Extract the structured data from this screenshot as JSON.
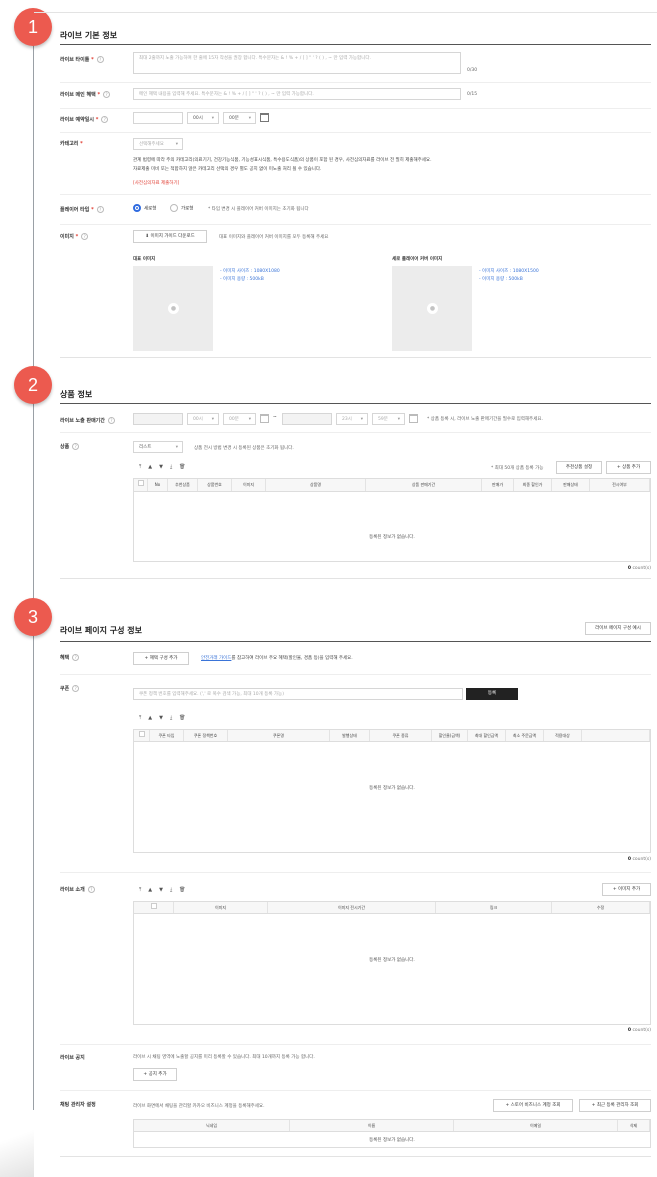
{
  "steps": [
    "1",
    "2",
    "3"
  ],
  "s1": {
    "title": "라이브 기본 정보",
    "live_title_label": "라이브 타이틀",
    "live_title_ph": "최대 2줄까지 노출 가능하며 한 줄에 15자 작성을 권장 합니다. 특수문자는 & ! % + / [ ] \" ' ? ( ) , ~ 만 입력 가능합니다.",
    "live_title_count": "0/30",
    "benefit_label": "라이브 메인 혜택",
    "benefit_ph": "메인 혜택 내용을 입력해 주세요. 특수문자는 & ! % + / [ ] \" ' ? ( ) , ~ 만 입력 가능합니다.",
    "benefit_count": "0/15",
    "schedule_label": "라이브 예약일시",
    "hour": "00시",
    "minute": "00분",
    "category_label": "카테고리",
    "category_select": "선택해주세요",
    "category_note1": "관계 법령에 따라 주의 카테고리(의료기기, 건강기능식품, 기능성표시식품, 특수용도식품)의 상품이 포함 된 경우, 사전심의자료를 라이브 전 필히 제출해주세요.",
    "category_note2": "자료제출 미비 또는 적합하지 않은 카테고리 선택의 경우 별도 공지 없이 미노출 처리 될 수 있습니다.",
    "category_link": "[사전심의자료 제출하기]",
    "player_label": "플레이어 타입",
    "player_vertical": "세로형",
    "player_horizontal": "가로형",
    "player_note": "* 타입 변경 시 플레이어 커버 이미지는 초기화 됩니다",
    "image_label": "이미지",
    "image_guide_btn": "이미지 가이드 다운로드",
    "image_note": "대표 이미지와 플레이어 커버 이미지를 모두 등록해 주세요",
    "rep_image_title": "대표 이미지",
    "rep_size": "- 이미지 사이즈 : 1080X1080",
    "rep_capacity": "- 이미지 용량 : 500kB",
    "cover_image_title": "세로 플레이어 커버 이미지",
    "cover_size": "- 이미지 사이즈 : 1080X1500",
    "cover_capacity": "- 이미지 용량 : 500kB"
  },
  "s2": {
    "title": "상품 정보",
    "period_label": "라이브 노출 판매기간",
    "start_hour": "00시",
    "start_min": "00분",
    "tilde": "~",
    "end_hour": "23시",
    "end_min": "59분",
    "period_note": "* 상품 등록 시, 라이브 노출 판매기간을 필수로 입력해주세요.",
    "product_label": "상품",
    "view_select": "리스트",
    "view_note": "상품 전시 방법 변경 시 등록된 상품은 초기화 됩니다.",
    "max_note": "* 최대 50개 상품 등록 가능",
    "recommend_btn": "추천상품 설정",
    "add_product_btn": "상품 추가",
    "columns": [
      "No",
      "추천상품",
      "상품번호",
      "이미지",
      "상품명",
      "상품 판매기간",
      "판매가",
      "최종 할인가",
      "판매상태",
      "전시여부"
    ],
    "empty": "등록된 정보가 없습니다.",
    "count_num": "0",
    "count_unit": "count(s)"
  },
  "s3": {
    "title": "라이브 페이지 구성 정보",
    "example_btn": "라이브 페이지 구성 예시",
    "benefit_label": "혜택",
    "benefit_btn": "혜택 구성 추가",
    "benefit_link": "안전거래 가이드",
    "benefit_note": "를 참고하여 라이브 주요 혜택(할인율, 경품 등)을 입력해 주세요.",
    "coupon_label": "쿠폰",
    "coupon_ph": "쿠폰 정책 번호를 입력해주세요. (',' 로 복수 검색 가능, 최대 10개 등록 가능)",
    "coupon_register": "등록",
    "coupon_columns": [
      "",
      "쿠폰 타입",
      "쿠폰 정책번호",
      "쿠폰명",
      "발행상태",
      "쿠폰 종류",
      "할인율(금액)",
      "최대 할인금액",
      "최소 주문금액",
      "적용대상",
      ""
    ],
    "coupon_empty": "등록된 정보가 없습니다.",
    "coupon_count": "0",
    "coupon_unit": "count(s)",
    "intro_label": "라이브 소개",
    "intro_add_btn": "이미지 추가",
    "intro_columns": [
      "",
      "이미지",
      "이미지 전시기간",
      "링크",
      "수정"
    ],
    "intro_empty": "등록된 정보가 없습니다.",
    "intro_count": "0",
    "intro_unit": "count(s)",
    "notice_label": "라이브 공지",
    "notice_note": "라이브 시 채팅 영역에 노출할 공지를 미리 등록할 수 있습니다. 최대 10개까지 등록 가능 합니다.",
    "notice_btn": "공지 추가",
    "chat_label": "채팅 관리자 설정",
    "chat_note": "라이브 화면에서 채팅을 관리할 카카오 비즈니스 계정을 등록해주세요.",
    "store_btn": "스토어 비즈니스 계정 조회",
    "recent_btn": "최근 등록 관리자 조회",
    "chat_columns": [
      "닉네임",
      "이름",
      "이메일",
      "삭제"
    ],
    "chat_empty": "등록된 정보가 없습니다."
  }
}
